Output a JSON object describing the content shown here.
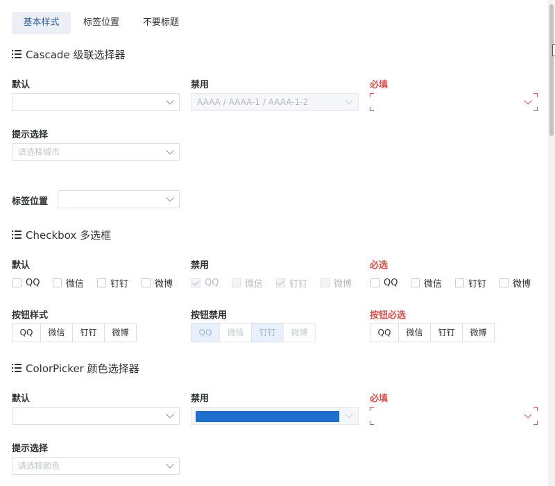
{
  "tabs": [
    "基本样式",
    "标签位置",
    "不要标题"
  ],
  "sections": {
    "cascade": "Cascade 级联选择器",
    "checkbox": "Checkbox 多选框",
    "colorpicker": "ColorPicker 颜色选择器"
  },
  "cascade": {
    "default_label": "默认",
    "disabled_label": "禁用",
    "disabled_value": "AAAA / AAAA-1 / AAAA-1-2",
    "required_label": "必填",
    "hint_label": "提示选择",
    "hint_placeholder": "请选择城市",
    "position_label": "标签位置"
  },
  "checkbox": {
    "default_label": "默认",
    "disabled_label": "禁用",
    "required_label": "必选",
    "options": [
      "QQ",
      "微信",
      "钉钉",
      "微博"
    ],
    "disabled_checked": [
      true,
      false,
      true,
      false
    ],
    "button_style_label": "按钮样式",
    "button_disabled_label": "按钮禁用",
    "button_required_label": "按钮必选",
    "button_disabled_selected": [
      true,
      false,
      true,
      false
    ]
  },
  "colorpicker": {
    "default_label": "默认",
    "disabled_label": "禁用",
    "disabled_color": "#1e6fce",
    "required_label": "必填",
    "hint_label": "提示选择",
    "hint_placeholder": "请选择颜色"
  },
  "colors": {
    "accent": "#2c5aa0",
    "required": "#e0524b",
    "swatch": "#1e6fce"
  }
}
